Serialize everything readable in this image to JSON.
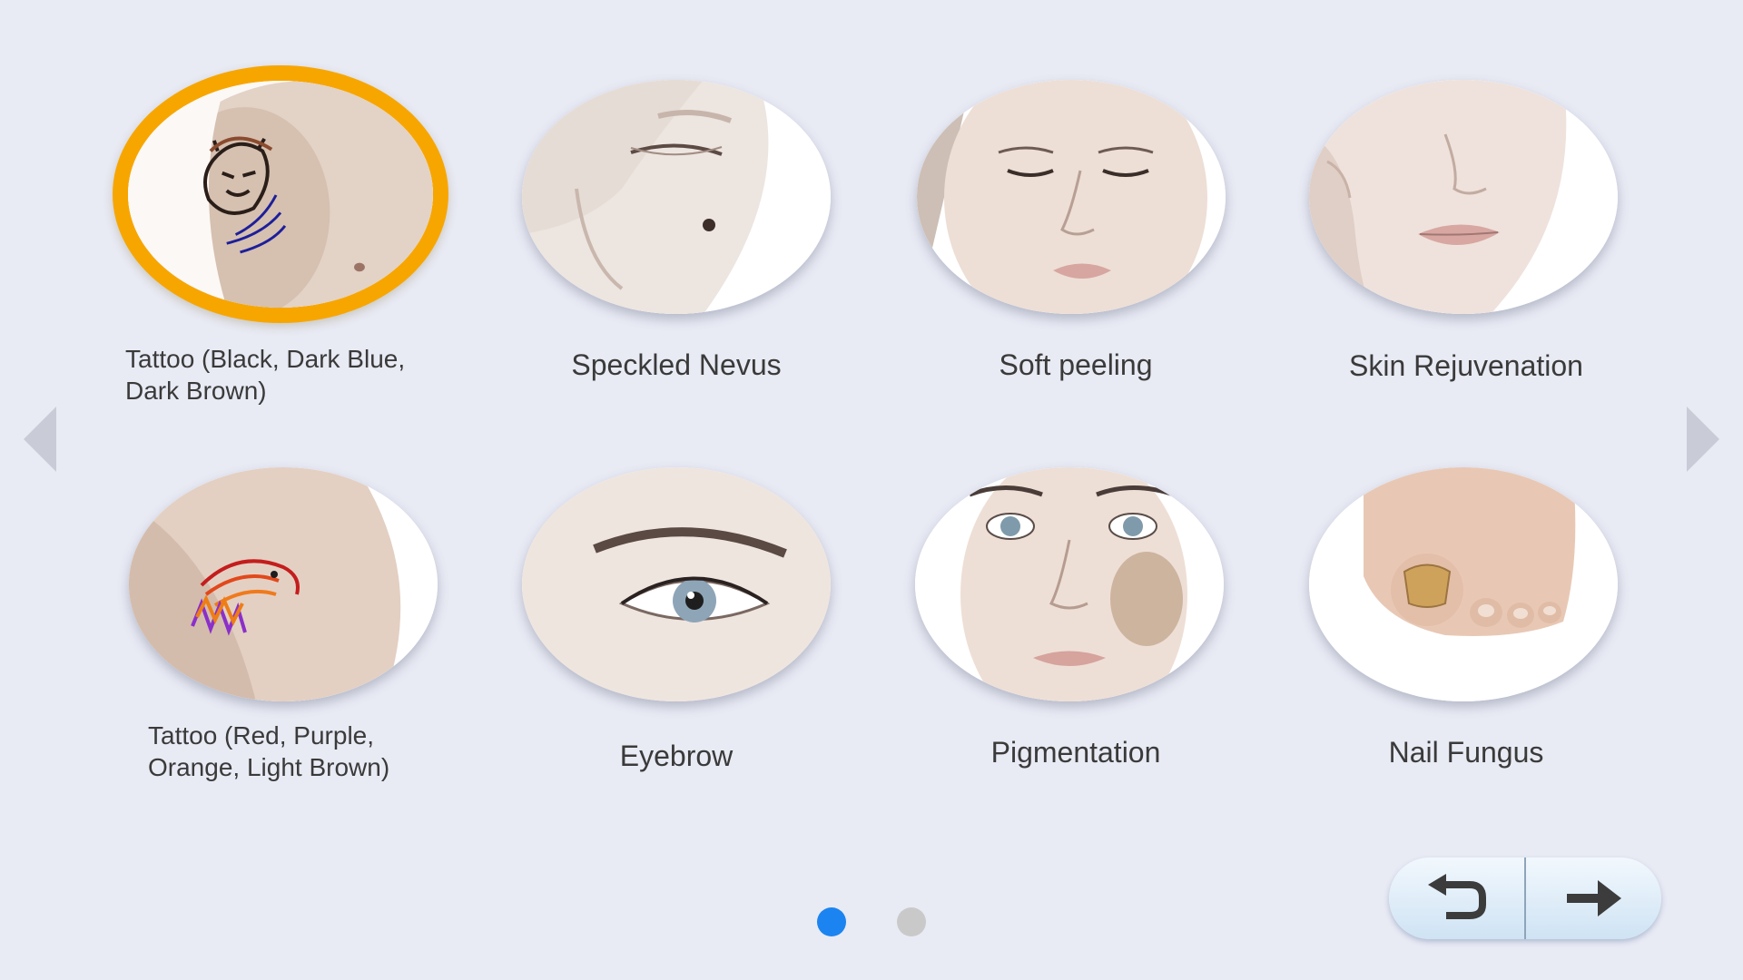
{
  "treatments": [
    {
      "label": "Tattoo (Black, Dark Blue, Dark Brown)",
      "label_line1": "Tattoo (Black, Dark Blue,",
      "label_line2": "Dark Brown)",
      "selected": true
    },
    {
      "label": "Speckled Nevus"
    },
    {
      "label": "Soft peeling"
    },
    {
      "label": "Skin Rejuvenation"
    },
    {
      "label": "Tattoo (Red, Purple, Orange, Light Brown)",
      "label_line1": "Tattoo (Red, Purple,",
      "label_line2": "Orange, Light Brown)"
    },
    {
      "label": "Eyebrow"
    },
    {
      "label": "Pigmentation"
    },
    {
      "label": "Nail Fungus"
    }
  ],
  "pagination": {
    "current_page": 1,
    "total_pages": 2
  },
  "colors": {
    "background": "#e8eaf4",
    "selection_ring": "#f7a600",
    "active_dot": "#1b84f0",
    "inactive_dot": "#c9c9c9"
  },
  "icons": {
    "prev": "triangle-left-icon",
    "next": "triangle-right-icon",
    "back": "return-arrow-icon",
    "forward": "arrow-right-icon"
  }
}
